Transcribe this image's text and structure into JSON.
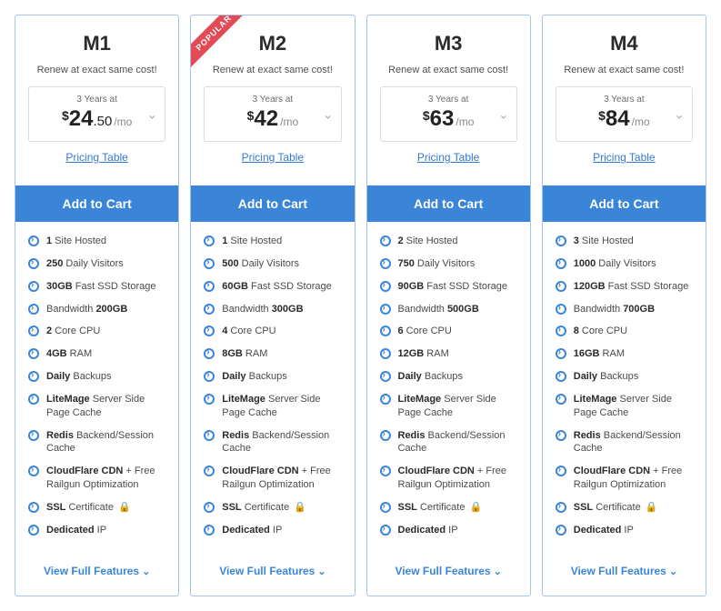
{
  "common": {
    "renew_text": "Renew at exact same cost!",
    "term_text": "3 Years at",
    "per_text": "/mo",
    "pricing_table_label": "Pricing Table",
    "add_to_cart_label": "Add to Cart",
    "view_full_label": "View Full Features",
    "popular_label": "POPULAR"
  },
  "plans": [
    {
      "name": "M1",
      "popular": false,
      "price_int": "24",
      "price_dec": ".50",
      "features": [
        "<b>1</b> Site Hosted",
        "<b>250</b> Daily Visitors",
        "<b>30GB</b> Fast SSD Storage",
        "Bandwidth <b>200GB</b>",
        "<b>2</b> Core CPU",
        "<b>4GB</b> RAM",
        "<b>Daily</b> Backups",
        "<b>LiteMage</b> Server Side Page Cache",
        "<b>Redis</b> Backend/Session Cache",
        "<b>CloudFlare CDN</b> + Free Railgun Optimization",
        "<b>SSL</b> Certificate <span class='lock'>&#128274;</span>",
        "<b>Dedicated</b> IP"
      ]
    },
    {
      "name": "M2",
      "popular": true,
      "price_int": "42",
      "price_dec": "",
      "features": [
        "<b>1</b> Site Hosted",
        "<b>500</b> Daily Visitors",
        "<b>60GB</b> Fast SSD Storage",
        "Bandwidth <b>300GB</b>",
        "<b>4</b> Core CPU",
        "<b>8GB</b> RAM",
        "<b>Daily</b> Backups",
        "<b>LiteMage</b> Server Side Page Cache",
        "<b>Redis</b> Backend/Session Cache",
        "<b>CloudFlare CDN</b> + Free Railgun Optimization",
        "<b>SSL</b> Certificate <span class='lock'>&#128274;</span>",
        "<b>Dedicated</b> IP"
      ]
    },
    {
      "name": "M3",
      "popular": false,
      "price_int": "63",
      "price_dec": "",
      "features": [
        "<b>2</b> Site Hosted",
        "<b>750</b> Daily Visitors",
        "<b>90GB</b> Fast SSD Storage",
        "Bandwidth <b>500GB</b>",
        "<b>6</b> Core CPU",
        "<b>12GB</b> RAM",
        "<b>Daily</b> Backups",
        "<b>LiteMage</b> Server Side Page Cache",
        "<b>Redis</b> Backend/Session Cache",
        "<b>CloudFlare CDN</b> + Free Railgun Optimization",
        "<b>SSL</b> Certificate <span class='lock'>&#128274;</span>",
        "<b>Dedicated</b> IP"
      ]
    },
    {
      "name": "M4",
      "popular": false,
      "price_int": "84",
      "price_dec": "",
      "features": [
        "<b>3</b> Site Hosted",
        "<b>1000</b> Daily Visitors",
        "<b>120GB</b> Fast SSD Storage",
        "Bandwidth <b>700GB</b>",
        "<b>8</b> Core CPU",
        "<b>16GB</b> RAM",
        "<b>Daily</b> Backups",
        "<b>LiteMage</b> Server Side Page Cache",
        "<b>Redis</b> Backend/Session Cache",
        "<b>CloudFlare CDN</b> + Free Railgun Optimization",
        "<b>SSL</b> Certificate <span class='lock'>&#128274;</span>",
        "<b>Dedicated</b> IP"
      ]
    }
  ]
}
